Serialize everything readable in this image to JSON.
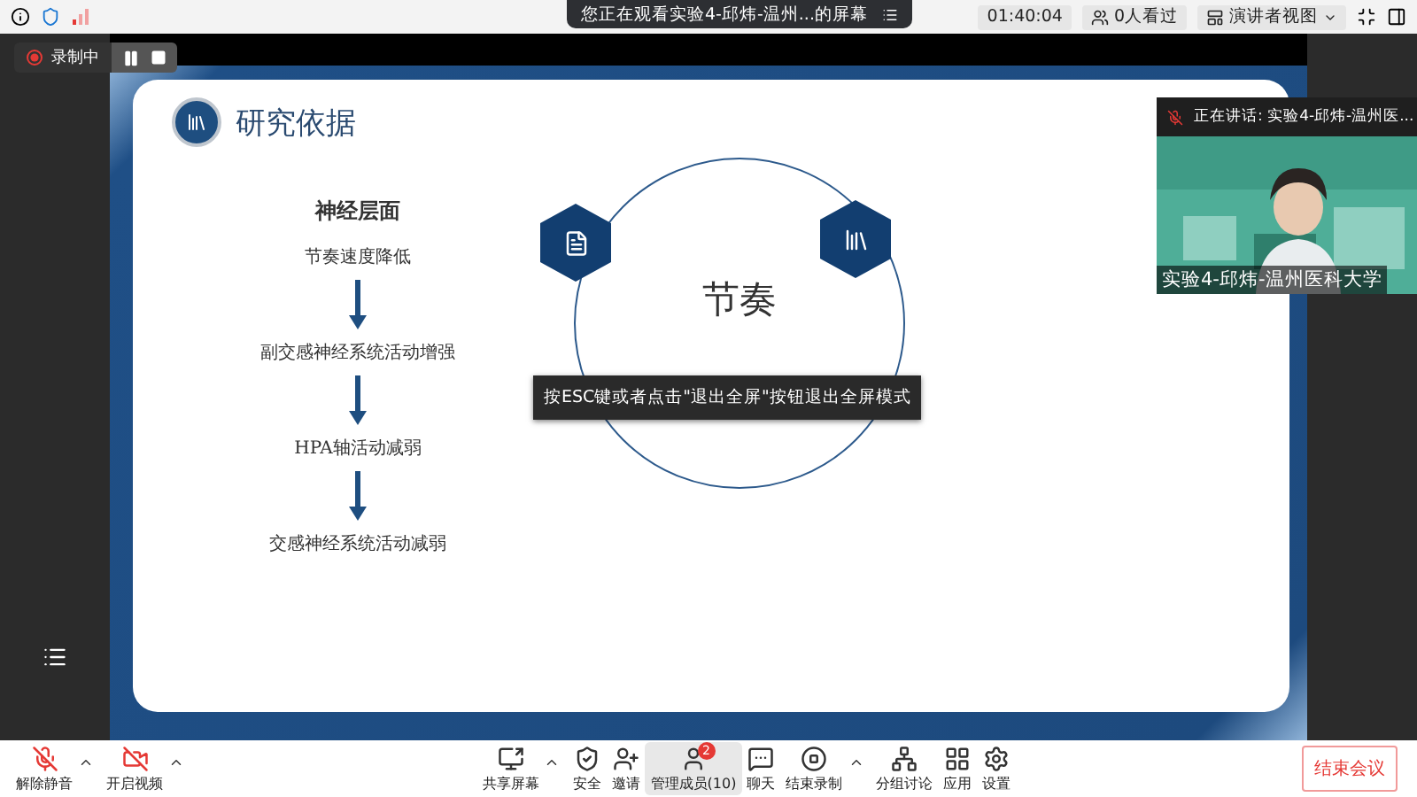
{
  "top_bar": {
    "share_notice": "您正在观看实验4-邱炜-温州...的屏幕",
    "timer": "01:40:04",
    "viewers": "0人看过",
    "view_mode": "演讲者视图"
  },
  "recording": {
    "label": "录制中"
  },
  "slide": {
    "title": "研究依据",
    "flow_heading": "神经层面",
    "flow_steps": [
      "节奏速度降低",
      "副交感神经系统活动增强",
      "HPA轴活动减弱",
      "交感神经系统活动减弱"
    ],
    "circle_label": "节奏"
  },
  "fullscreen_hint": "按ESC键或者点击\"退出全屏\"按钮退出全屏模式",
  "speaker_video": {
    "speaking": "正在讲话: 实验4-邱炜-温州医...",
    "name": "实验4-邱炜-温州医科大学"
  },
  "toolbar": {
    "left": [
      {
        "kind": "mic-off",
        "label": "解除静音",
        "menu": true
      },
      {
        "kind": "video-off",
        "label": "开启视频",
        "menu": true
      }
    ],
    "center": [
      {
        "kind": "share",
        "label": "共享屏幕",
        "menu": true,
        "selected": false
      },
      {
        "kind": "security",
        "label": "安全",
        "menu": false,
        "selected": false
      },
      {
        "kind": "invite",
        "label": "邀请",
        "menu": false,
        "selected": false
      },
      {
        "kind": "members",
        "label": "管理成员(10)",
        "menu": false,
        "selected": true,
        "badge": "2"
      },
      {
        "kind": "chat",
        "label": "聊天",
        "menu": false,
        "selected": false
      },
      {
        "kind": "record-stop",
        "label": "结束录制",
        "menu": true,
        "selected": false
      },
      {
        "kind": "breakout",
        "label": "分组讨论",
        "menu": false,
        "selected": false
      },
      {
        "kind": "apps",
        "label": "应用",
        "menu": false,
        "selected": false
      },
      {
        "kind": "settings",
        "label": "设置",
        "menu": false,
        "selected": false
      }
    ],
    "end_button": "结束会议"
  }
}
